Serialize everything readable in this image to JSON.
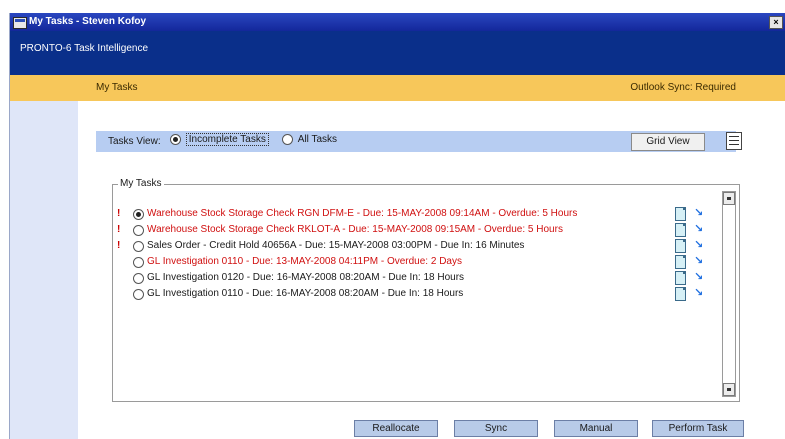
{
  "window": {
    "title": "My Tasks - Steven Kofoy",
    "close_glyph": "×"
  },
  "app_header": {
    "name": "PRONTO-6 Task Intelligence"
  },
  "tasks_bar": {
    "title": "My Tasks",
    "sync_status": "Outlook Sync: Required"
  },
  "view_bar": {
    "label": "Tasks View:",
    "options": [
      {
        "label": "Incomplete Tasks",
        "selected": true
      },
      {
        "label": "All Tasks",
        "selected": false
      }
    ],
    "grid_view_label": "Grid View",
    "list_icon": "list-icon"
  },
  "task_group": {
    "legend": "My Tasks",
    "tasks": [
      {
        "priority": "!",
        "selected": true,
        "overdue": true,
        "text": "Warehouse Stock Storage Check RGN DFM-E  -  Due: 15-MAY-2008 09:14AM - Overdue: 5 Hours"
      },
      {
        "priority": "!",
        "selected": false,
        "overdue": true,
        "text": "Warehouse Stock Storage Check RKLOT-A  -  Due: 15-MAY-2008 09:15AM - Overdue: 5 Hours"
      },
      {
        "priority": "!",
        "selected": false,
        "overdue": false,
        "text": "Sales Order - Credit Hold 40656A  -  Due: 15-MAY-2008 03:00PM - Due In: 16 Minutes"
      },
      {
        "priority": "",
        "selected": false,
        "overdue": true,
        "text": "GL Investigation 0110  -  Due: 13-MAY-2008 04:11PM - Overdue: 2 Days"
      },
      {
        "priority": "",
        "selected": false,
        "overdue": false,
        "text": "GL Investigation 0120  -  Due: 16-MAY-2008 08:20AM - Due In: 18 Hours"
      },
      {
        "priority": "",
        "selected": false,
        "overdue": false,
        "text": "GL Investigation 0110  -  Due: 16-MAY-2008 08:20AM - Due In: 18 Hours"
      }
    ]
  },
  "actions": {
    "reallocate": "Reallocate",
    "sync": "Sync",
    "manual": "Manual",
    "perform_task": "Perform Task"
  },
  "colors": {
    "title_bar": "#13279a",
    "app_header": "#0a2f8a",
    "tasks_bar": "#f7c75a",
    "view_bar": "#b7cdf2",
    "overdue_text": "#d01010"
  }
}
